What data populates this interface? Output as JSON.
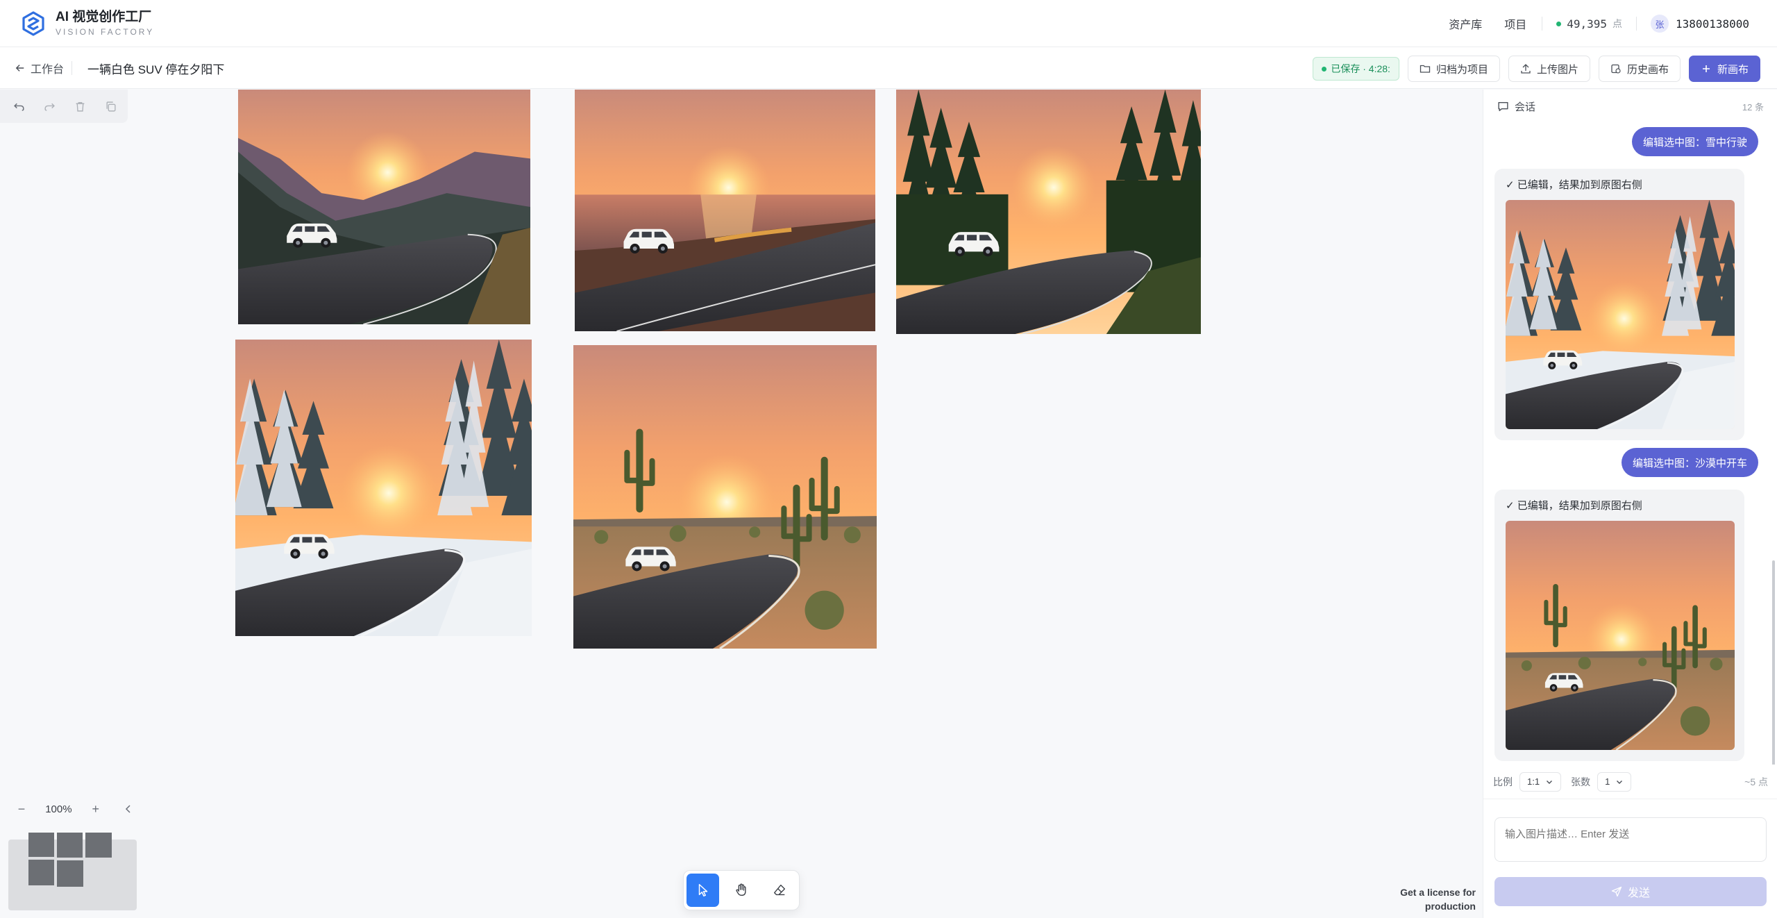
{
  "app": {
    "title": "AI 视觉创作工厂",
    "subtitle": "VISION FACTORY",
    "brand_color": "#5b63d3"
  },
  "topnav": {
    "links": [
      "资产库",
      "项目"
    ],
    "credits_value": "49,395",
    "credits_unit": "点",
    "avatar_initial": "张",
    "phone": "13800138000"
  },
  "subheader": {
    "back_label": "工作台",
    "canvas_title": "一辆白色 SUV 停在夕阳下",
    "saved_status": "已保存 · 4:28:",
    "buttons": {
      "archive": "归档为项目",
      "upload": "上传图片",
      "history": "历史画布",
      "new_canvas": "新画布"
    }
  },
  "canvas": {
    "edit_tools": [
      "undo-icon",
      "redo-icon",
      "trash-icon",
      "copy-icon"
    ],
    "images": [
      {
        "scene": "mountain",
        "description_icon": "image"
      },
      {
        "scene": "ocean"
      },
      {
        "scene": "forest"
      },
      {
        "scene": "snow"
      },
      {
        "scene": "desert"
      }
    ],
    "zoom": "100%",
    "tools": [
      "select-icon",
      "hand-icon",
      "eraser-icon"
    ],
    "active_tool": "select-icon",
    "license_text": "Get a license for production"
  },
  "chat": {
    "title": "会话",
    "count": "12 条",
    "messages": [
      {
        "role": "user",
        "text": "编辑选中图：雪中行驶"
      },
      {
        "role": "ai",
        "text": "✓ 已编辑，结果加到原图右侧",
        "image_scene": "snow"
      },
      {
        "role": "user",
        "text": "编辑选中图：沙漠中开车"
      },
      {
        "role": "ai",
        "text": "✓ 已编辑，结果加到原图右侧",
        "image_scene": "desert"
      }
    ],
    "options": {
      "ratio_label": "比例",
      "ratio_value": "1:1",
      "count_label": "张数",
      "count_value": "1",
      "cost": "~5 点"
    },
    "input_placeholder": "输入图片描述… Enter 发送",
    "send_label": "发送"
  }
}
